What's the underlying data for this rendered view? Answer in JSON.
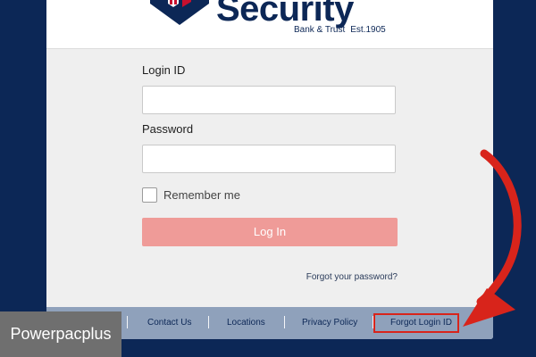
{
  "brand": {
    "name": "Security",
    "tagline": "Bank & Trust",
    "established": "Est.1905"
  },
  "form": {
    "login_id_label": "Login ID",
    "login_id_value": "",
    "password_label": "Password",
    "password_value": "",
    "remember_label": "Remember me",
    "remember_checked": false,
    "login_button_label": "Log In",
    "forgot_password_label": "Forgot your password?"
  },
  "footer": {
    "links": [
      "Contact Us",
      "Locations",
      "Privacy Policy",
      "Forgot Login ID"
    ]
  },
  "annotation": {
    "highlight_color": "#d8241b"
  },
  "watermark": "Powerpacplus",
  "colors": {
    "page_background": "#0c2756",
    "login_button": "#ef9b98",
    "footer_bar": "#8fa1bb"
  }
}
